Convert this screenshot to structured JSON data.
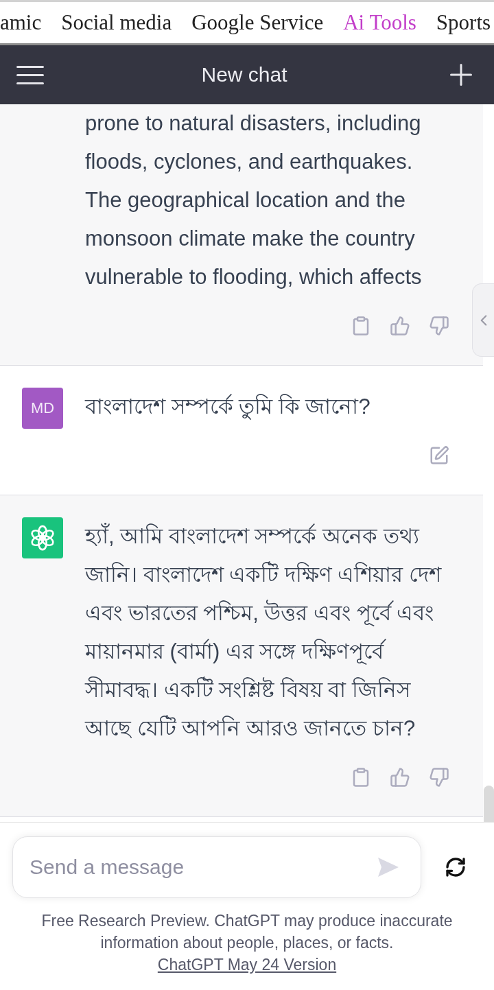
{
  "top_nav": {
    "items": [
      {
        "label": "amic",
        "selected": false
      },
      {
        "label": "Social media",
        "selected": false
      },
      {
        "label": "Google Service",
        "selected": false
      },
      {
        "label": "Ai Tools",
        "selected": true
      },
      {
        "label": "Sports",
        "selected": false
      }
    ]
  },
  "header": {
    "title": "New chat"
  },
  "messages": [
    {
      "kind": "assistant",
      "text": "prone to natural disasters, including floods, cyclones, and earthquakes. The geographical location and the monsoon climate make the country vulnerable to flooding, which affects"
    },
    {
      "kind": "user",
      "avatar": {
        "kind": "initials",
        "text": "MD"
      },
      "text": "বাংলাদেশ সম্পর্কে তুমি কি জানো?"
    },
    {
      "kind": "assistant",
      "avatar": {
        "kind": "logo"
      },
      "text": "হ্যাঁ, আমি বাংলাদেশ সম্পর্কে অনেক তথ্য জানি। বাংলাদেশ একটি দক্ষিণ এশিয়ার দেশ এবং ভারতের পশ্চিম, উত্তর এবং পূর্বে এবং মায়ানমার (বার্মা) এর সঙ্গে দক্ষিণপূর্বে সীমাবদ্ধ। একটি সংশ্লিষ্ট বিষয় বা জিনিস আছে যেটি আপনি আরও জানতে চান?"
    }
  ],
  "composer": {
    "placeholder": "Send a message"
  },
  "footer": {
    "text": "Free Research Preview. ChatGPT may produce inaccurate information about people, places, or facts.",
    "link": "ChatGPT May 24 Version"
  }
}
